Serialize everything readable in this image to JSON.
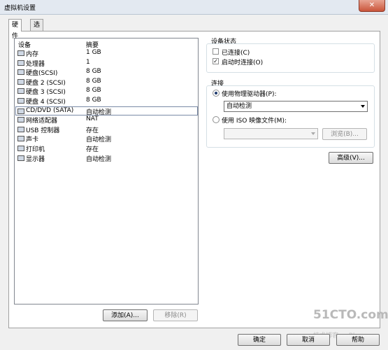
{
  "window": {
    "title": "虚拟机设置"
  },
  "tabs": [
    {
      "label": "硬件"
    },
    {
      "label": "选项"
    }
  ],
  "hardware_list": {
    "col_device": "设备",
    "col_summary": "摘要",
    "rows": [
      {
        "name": "内存",
        "summary": "1 GB",
        "icon": "memory-icon"
      },
      {
        "name": "处理器",
        "summary": "1",
        "icon": "processor-icon"
      },
      {
        "name": "硬盘(SCSI)",
        "summary": "8 GB",
        "icon": "disk-icon"
      },
      {
        "name": "硬盘 2 (SCSI)",
        "summary": "8 GB",
        "icon": "disk-icon"
      },
      {
        "name": "硬盘 3 (SCSI)",
        "summary": "8 GB",
        "icon": "disk-icon"
      },
      {
        "name": "硬盘 4 (SCSI)",
        "summary": "8 GB",
        "icon": "disk-icon"
      },
      {
        "name": "CD/DVD (SATA)",
        "summary": "自动检测",
        "icon": "cd-dvd-icon"
      },
      {
        "name": "网络适配器",
        "summary": "NAT",
        "icon": "network-icon"
      },
      {
        "name": "USB 控制器",
        "summary": "存在",
        "icon": "usb-icon"
      },
      {
        "name": "声卡",
        "summary": "自动检测",
        "icon": "sound-icon"
      },
      {
        "name": "打印机",
        "summary": "存在",
        "icon": "printer-icon"
      },
      {
        "name": "显示器",
        "summary": "自动检测",
        "icon": "display-icon"
      }
    ],
    "add_button": "添加(A)...",
    "remove_button": "移除(R)"
  },
  "device_status": {
    "label": "设备状态",
    "connected": "已连接(C)",
    "connect_on_power": "启动时连接(O)",
    "connected_checked": false,
    "connect_on_power_checked": true
  },
  "connection": {
    "label": "连接",
    "use_physical": "使用物理驱动器(P):",
    "physical_value": "自动检测",
    "use_iso": "使用 ISO 映像文件(M):",
    "iso_value": "",
    "browse_button": "浏览(B)..."
  },
  "advanced_button": "高级(V)...",
  "footer": {
    "ok": "确定",
    "cancel": "取消",
    "help": "帮助"
  },
  "watermark": {
    "logo": "51CTO.com",
    "sub": "技术博客 — Blog"
  }
}
